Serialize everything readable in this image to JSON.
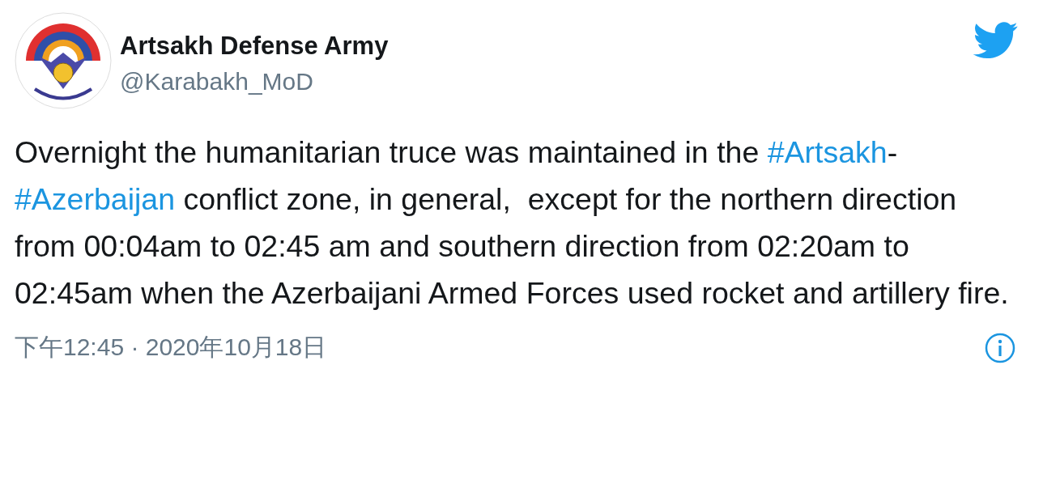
{
  "author": {
    "name": "Artsakh Defense Army",
    "handle": "@Karabakh_MoD"
  },
  "body": [
    {
      "kind": "text",
      "text": "Overnight the humanitarian truce was maintained in the "
    },
    {
      "kind": "hashtag",
      "text": "#Artsakh"
    },
    {
      "kind": "text",
      "text": "-"
    },
    {
      "kind": "hashtag",
      "text": "#Azerbaijan"
    },
    {
      "kind": "text",
      "text": " conflict zone, in general,  except for the northern direction from 00:04am to 02:45 am and southern direction from 02:20am to 02:45am when the Azerbaijani Armed Forces used rocket and artillery fire."
    }
  ],
  "timestamp": "下午12:45 · 2020年10月18日"
}
